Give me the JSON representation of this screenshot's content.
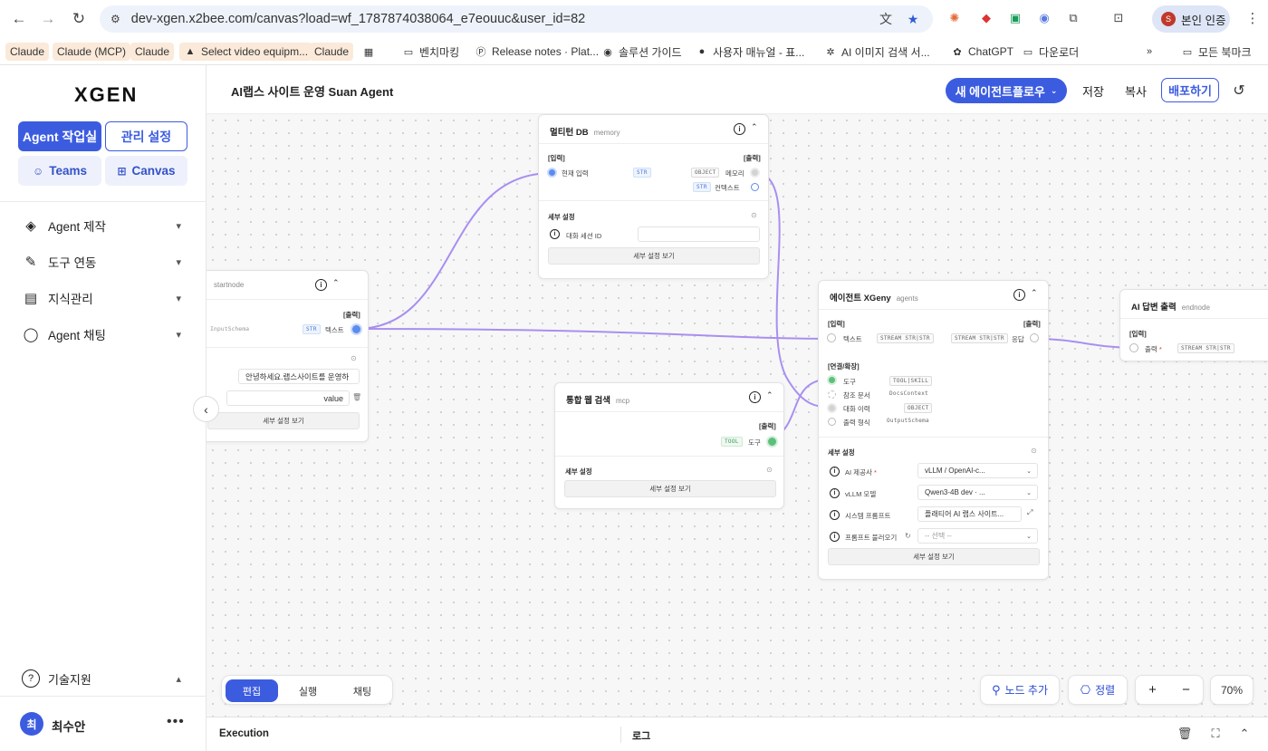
{
  "browser": {
    "url": "dev-xgen.x2bee.com/canvas?load=wf_1787874038064_e7eouuc&user_id=82",
    "profile_button": "본인 인증",
    "bookmarks": [
      "Claude",
      "Claude (MCP)",
      "Claude",
      "Select video equipm...",
      "Claude",
      "벤치마킹",
      "Release notes · Plat...",
      "솔루션 가이드",
      "사용자 매뉴얼 - 표...",
      "AI 이미지 검색 서...",
      "ChatGPT",
      "다운로더",
      "모든 북마크"
    ]
  },
  "sidebar": {
    "logo": "XGEN",
    "agent_workspace": "Agent 작업실",
    "admin_settings": "관리 설정",
    "teams": "Teams",
    "canvas": "Canvas",
    "menu": [
      {
        "label": "Agent 제작",
        "icon": "layers-icon"
      },
      {
        "label": "도구 연동",
        "icon": "wrench-icon"
      },
      {
        "label": "지식관리",
        "icon": "book-icon"
      },
      {
        "label": "Agent 채팅",
        "icon": "chat-icon"
      }
    ],
    "support": "기술지원",
    "user": {
      "initial": "최",
      "name": "최수안"
    }
  },
  "header": {
    "title": "AI랩스 사이트 운영 Suan Agent",
    "new_flow": "새 에이전트플로우",
    "save": "저장",
    "copy": "복사",
    "deploy": "배포하기"
  },
  "nodes": {
    "memory": {
      "title": "멀티턴 DB",
      "subtitle": "memory",
      "input_label": "[입력]",
      "output_label": "[출력]",
      "in_port": "현재 입력",
      "in_type": "STR",
      "out1": "메모리",
      "out1_type": "OBJECT",
      "out2": "컨텍스트",
      "out2_type": "STR",
      "settings_title": "세부 설정",
      "session_label": "대화 세션 ID",
      "settings_btn": "세부 설정 보기"
    },
    "start": {
      "title": "startnode",
      "output_label": "[출력]",
      "schema": "InputSchema",
      "out_type": "STR",
      "out_port": "텍스트",
      "text_value": "안녕하세요.랩스사이트를 운영하",
      "value_label": "value",
      "settings_btn": "세부 설정 보기"
    },
    "mcp": {
      "title": "통합 웹 검색",
      "subtitle": "mcp",
      "output_label": "[출력]",
      "out_type": "TOOL",
      "out_port": "도구",
      "settings_title": "세부 설정",
      "settings_btn": "세부 설정 보기"
    },
    "agent": {
      "title": "에이전트 XGeny",
      "subtitle": "agents",
      "input_label": "[입력]",
      "output_label": "[출력]",
      "in_text": "텍스트",
      "in_text_type": "STREAM STR|STR",
      "out_type": "STREAM STR|STR",
      "out_port": "응답",
      "conn_label": "[연결/확장]",
      "tool": "도구",
      "tool_type": "TOOL|SKILL",
      "docs": "참조 문서",
      "docs_type": "DocsContext",
      "history": "대화 이력",
      "history_type": "OBJECT",
      "format": "출력 형식",
      "format_type": "OutputSchema",
      "settings_title": "세부 설정",
      "provider_label": "AI 제공사",
      "provider_value": "vLLM / OpenAI-c...",
      "model_label": "vLLM 모델",
      "model_value": "Qwen3-4B dev · ...",
      "prompt_label": "시스템 프롬프트",
      "prompt_value": "플래티어 AI 랩스 사이트...",
      "load_label": "프롬프트 불러오기",
      "load_value": "-- 선택 --",
      "settings_btn": "세부 설정 보기"
    },
    "end": {
      "title": "AI 답변 출력",
      "subtitle": "endnode",
      "input_label": "[입력]",
      "in_port": "출력",
      "in_type": "STREAM STR|STR"
    }
  },
  "toolbar": {
    "modes": [
      "편집",
      "실행",
      "채팅"
    ],
    "active_mode": "편집",
    "add_node": "노드 추가",
    "arrange": "정렬",
    "zoom_in": "+",
    "zoom_out": "−",
    "zoom": "70%"
  },
  "execution": {
    "label": "Execution",
    "log": "로그"
  },
  "colors": {
    "accent": "#3c5ce0",
    "edge": "#a98ff0"
  }
}
